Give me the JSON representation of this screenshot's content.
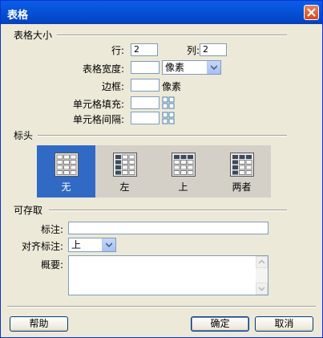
{
  "window": {
    "title": "表格"
  },
  "table_size": {
    "group_title": "表格大小",
    "rows_label": "行:",
    "rows_value": "2",
    "cols_label": "列:",
    "cols_value": "2",
    "width_label": "表格宽度:",
    "width_value": "",
    "width_unit_selected": "像素",
    "border_label": "边框:",
    "border_value": "",
    "border_unit": "像素",
    "padding_label": "单元格填充:",
    "padding_value": "",
    "spacing_label": "单元格间隔:",
    "spacing_value": ""
  },
  "header": {
    "group_title": "标头",
    "options": [
      {
        "label": "无",
        "icon": "table-no-header-icon",
        "selected": true
      },
      {
        "label": "左",
        "icon": "table-left-header-icon",
        "selected": false
      },
      {
        "label": "上",
        "icon": "table-top-header-icon",
        "selected": false
      },
      {
        "label": "两者",
        "icon": "table-both-headers-icon",
        "selected": false
      }
    ]
  },
  "accessibility": {
    "group_title": "可存取",
    "caption_label": "标注:",
    "caption_value": "",
    "align_label": "对齐标注:",
    "align_selected": "上",
    "summary_label": "概要:",
    "summary_value": ""
  },
  "buttons": {
    "help": "帮助",
    "ok": "确定",
    "cancel": "取消"
  },
  "colors": {
    "title_bar": "#0a5ee6",
    "selection": "#316ac5",
    "dialog_bg": "#ece9d8"
  }
}
